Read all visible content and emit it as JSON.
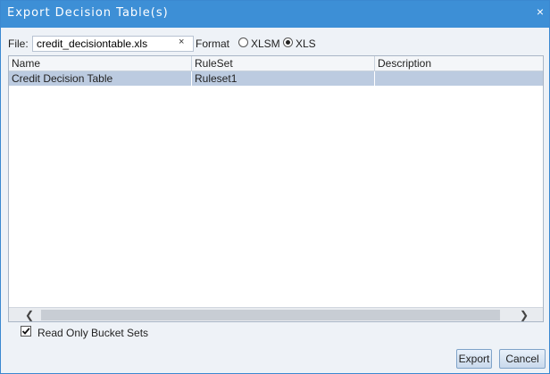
{
  "dialog": {
    "title": "Export Decision Table(s)",
    "close_glyph": "×"
  },
  "file": {
    "label": "File:",
    "value": "credit_decisiontable.xls",
    "clear_glyph": "×"
  },
  "format": {
    "label": "Format",
    "options": [
      {
        "label": "XLSM",
        "selected": false
      },
      {
        "label": "XLS",
        "selected": true
      }
    ]
  },
  "table": {
    "columns": [
      "Name",
      "RuleSet",
      "Description"
    ],
    "rows": [
      {
        "name": "Credit Decision Table",
        "ruleset": "Ruleset1",
        "description": "",
        "selected": true
      }
    ],
    "scroll_left_glyph": "❮",
    "scroll_right_glyph": "❯"
  },
  "options": {
    "read_only_bucket_sets": {
      "label": "Read Only Bucket Sets",
      "checked": true
    }
  },
  "buttons": {
    "export": "Export",
    "cancel": "Cancel"
  },
  "colors": {
    "titlebar": "#3d8fd6",
    "selected_row": "#bccbe0",
    "dialog_bg": "#eef2f7"
  },
  "icons": {
    "close": "close-icon",
    "clear": "clear-icon",
    "check": "check-icon"
  }
}
